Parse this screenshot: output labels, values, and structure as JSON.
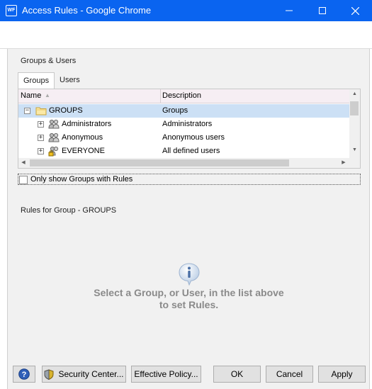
{
  "window": {
    "app_icon_label": "WF",
    "title": "Access Rules - Google Chrome"
  },
  "groups_section": {
    "label": "Groups & Users",
    "tabs": [
      {
        "label": "Groups",
        "active": true
      },
      {
        "label": "Users",
        "active": false
      }
    ],
    "columns": {
      "name": "Name",
      "description": "Description"
    },
    "rows": [
      {
        "expander": "−",
        "icon": "folder-icon",
        "name": "GROUPS",
        "description": "Groups",
        "selected": true
      },
      {
        "expander": "+",
        "icon": "users-icon",
        "name": "Administrators",
        "description": "Administrators",
        "selected": false
      },
      {
        "expander": "+",
        "icon": "users-icon",
        "name": "Anonymous",
        "description": "Anonymous users",
        "selected": false
      },
      {
        "expander": "+",
        "icon": "locked-users-icon",
        "name": "EVERYONE",
        "description": "All defined users",
        "selected": false
      }
    ],
    "filter_checkbox": {
      "label": "Only show Groups with Rules",
      "checked": false
    }
  },
  "rules_section": {
    "label": "Rules for Group - GROUPS",
    "empty_message_line1": "Select a Group, or User, in the list above",
    "empty_message_line2": "to set Rules."
  },
  "footer": {
    "help_icon": "help-icon",
    "security_center": "Security Center...",
    "effective_policy": "Effective Policy...",
    "ok": "OK",
    "cancel": "Cancel",
    "apply": "Apply"
  },
  "colors": {
    "titlebar": "#0a64f0",
    "selection": "#cce0f5",
    "empty_message": "#8a8a8a"
  }
}
